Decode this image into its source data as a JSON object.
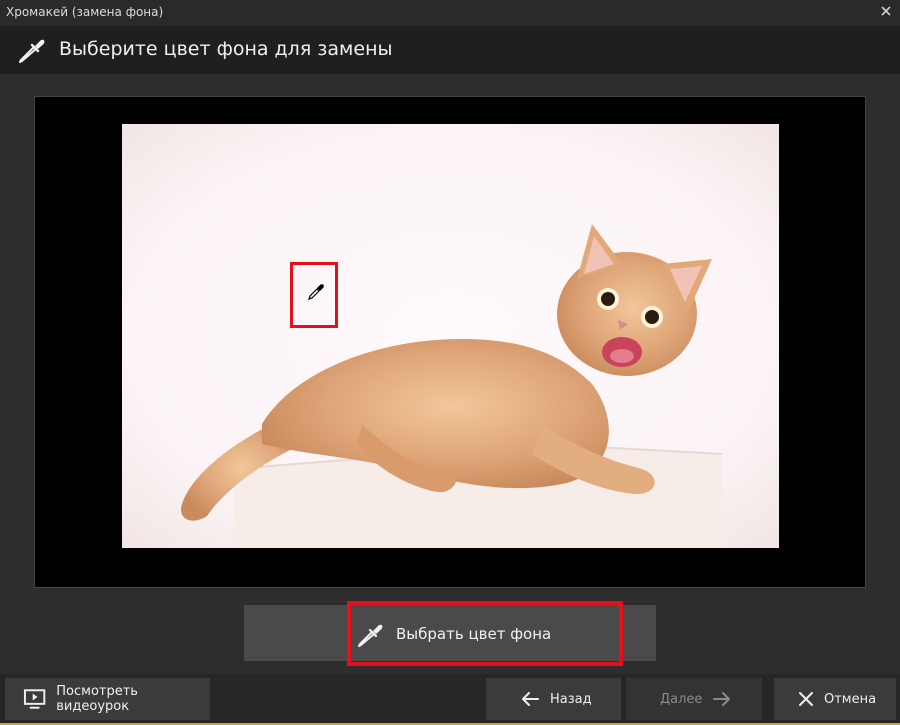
{
  "window": {
    "title": "Хромакей (замена фона)",
    "close_icon": "close-icon"
  },
  "header": {
    "title": "Выберите цвет фона для замены",
    "icon": "eyedropper-icon"
  },
  "preview": {
    "image": "kitten-photo",
    "cursor_icon": "eyedropper-cursor-icon"
  },
  "pick_button": {
    "label": "Выбрать цвет фона",
    "icon": "eyedropper-icon"
  },
  "footer": {
    "video_label": "Посмотреть видеоурок",
    "back_label": "Назад",
    "next_label": "Далее",
    "cancel_label": "Отмена"
  },
  "colors": {
    "highlight": "#e3101b",
    "background": "#2d2d2d"
  }
}
